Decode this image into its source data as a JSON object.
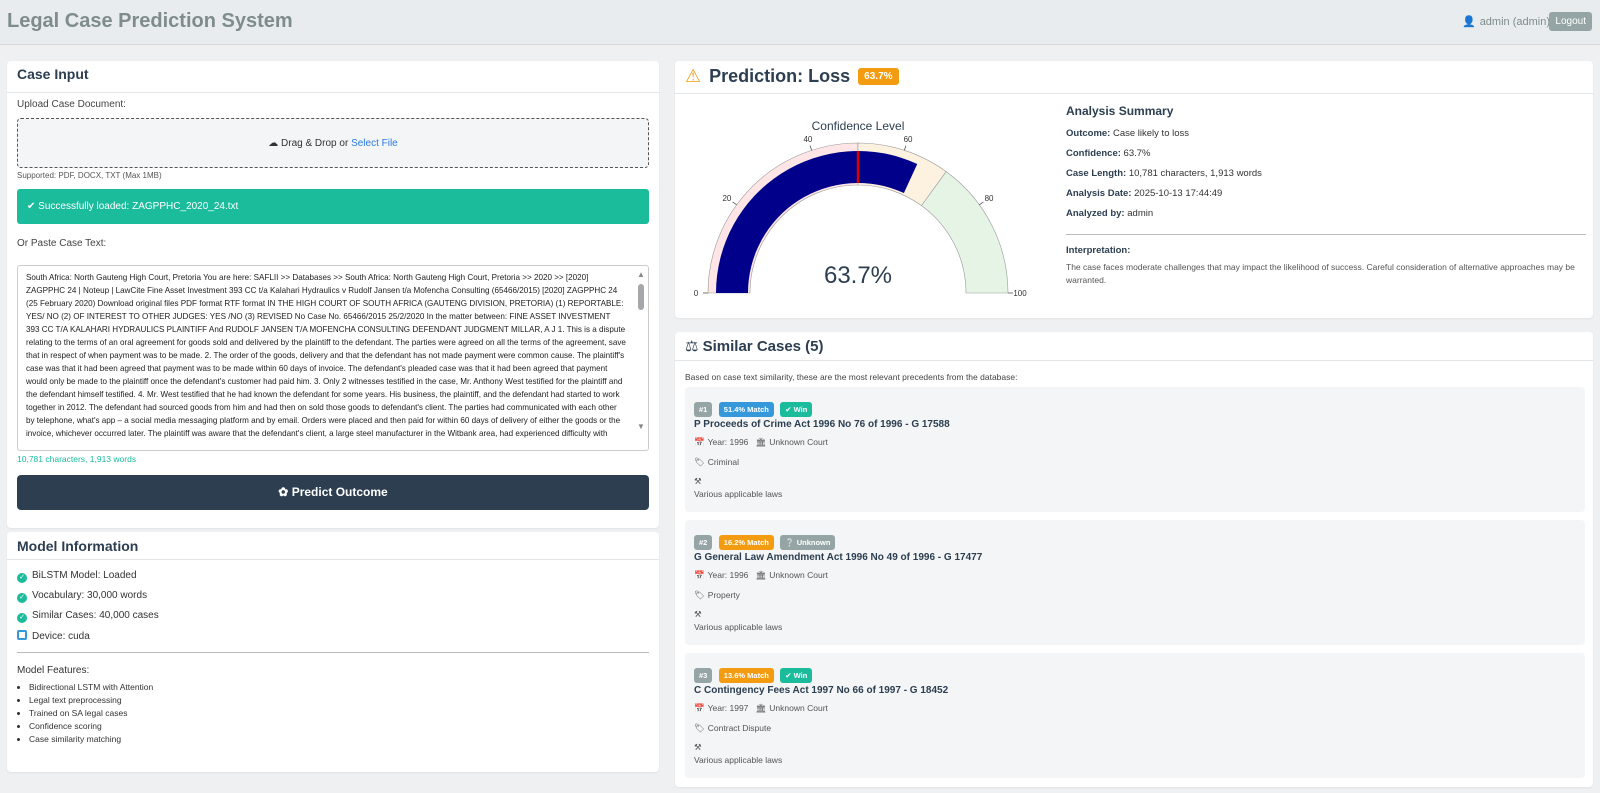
{
  "app": {
    "title": "Legal Case Prediction System"
  },
  "user": {
    "label": "admin (admin)",
    "logout": "Logout"
  },
  "case_input": {
    "title": "Case Input",
    "upload_label": "Upload Case Document:",
    "drop_text": "Drag & Drop or",
    "select_file": "Select File",
    "supported": "Supported: PDF, DOCX, TXT (Max 1MB)",
    "success": "Successfully loaded: ZAGPPHC_2020_24.txt",
    "paste_label": "Or Paste Case Text:",
    "text": "South Africa: North Gauteng High Court, Pretoria You are here: SAFLII >> Databases >> South Africa: North Gauteng High Court, Pretoria >> 2020 >> [2020] ZAGPPHC 24 | Noteup | LawCite Fine Asset Investment 393 CC t/a Kalahari Hydraulics v Rudolf Jansen t/a Mofencha Consulting (65466/2015) [2020] ZAGPPHC 24 (25 February 2020) Download original files PDF format RTF format IN THE HIGH COURT OF SOUTH AFRICA (GAUTENG DIVISION, PRETORIA) (1) REPORTABLE: YES/ NO (2) OF INTEREST TO OTHER JUDGES: YES /NO (3) REVISED No Case No. 65466/2015 25/2/2020 In the matter between: FINE ASSET INVESTMENT 393 CC T/A KALAHARI HYDRAULICS PLAINTIFF And RUDOLF JANSEN T/A MOFENCHA CONSULTING DEFENDANT JUDGMENT MILLAR, A J 1. This is a dispute relating to the terms of an oral agreement for goods sold and delivered by the plaintiff to the defendant. The parties were agreed on all the terms of the agreement, save that in respect of when payment was to be made. 2. The order of the goods, delivery and that the defendant has not made payment were common cause. The plaintiff's case was that it had been agreed that payment was to be made within 60 days of invoice. The defendant's pleaded case was that it had been agreed that payment would only be made to the plaintiff once the defendant's customer had paid him. 3. Only 2 witnesses testified in the case, Mr. Anthony West testified for the plaintiff and the defendant himself testified. 4. Mr. West testified that he had known the defendant for some years. His business, the plaintiff, and the defendant had started to work together in 2012. The defendant had sourced goods from him and had then on sold those goods to defendant's client. The parties had communicated with each other by telephone, what's app – a social media messaging platform and by email. Orders were placed and then paid for within 60 days of delivery of either the goods or the invoice, whichever occurred later. The plaintiff was aware that the defendant's client, a large steel manufacturer in the Witbank area, had experienced difficulty with",
    "counter": "10,781 characters, 1,913 words",
    "predict_button": "Predict Outcome"
  },
  "model_info": {
    "title": "Model Information",
    "items": [
      "BiLSTM Model: Loaded",
      "Vocabulary: 30,000 words",
      "Similar Cases: 40,000 cases",
      "Device: cuda"
    ],
    "features_title": "Model Features:",
    "features": [
      "Bidirectional LSTM with Attention",
      "Legal text preprocessing",
      "Trained on SA legal cases",
      "Confidence scoring",
      "Case similarity matching"
    ]
  },
  "prediction": {
    "title": "Prediction: Loss",
    "badge": "63.7%",
    "summary_title": "Analysis Summary",
    "rows": [
      {
        "k": "Outcome:",
        "v": "Case likely to loss"
      },
      {
        "k": "Confidence:",
        "v": "63.7%"
      },
      {
        "k": "Case Length:",
        "v": "10,781 characters, 1,913 words"
      },
      {
        "k": "Analysis Date:",
        "v": "2025-10-13 17:44:49"
      },
      {
        "k": "Analyzed by:",
        "v": "admin"
      }
    ],
    "interpretation_title": "Interpretation:",
    "interpretation": "The case faces moderate challenges that may impact the likelihood of success. Careful consideration of alternative approaches may be warranted."
  },
  "chart_data": {
    "type": "gauge",
    "title": "Confidence Level",
    "value": 63.7,
    "value_label": "63.7%",
    "range": [
      0,
      100
    ],
    "threshold": 50,
    "ticks": [
      0,
      20,
      40,
      60,
      80,
      100
    ],
    "bands": [
      {
        "from": 0,
        "to": 50,
        "color": "#ffe5e5"
      },
      {
        "from": 50,
        "to": 70,
        "color": "#fdf2e0"
      },
      {
        "from": 70,
        "to": 100,
        "color": "#e6f4e6"
      }
    ],
    "bar_color": "#00008b",
    "threshold_color": "#dd0000"
  },
  "similar": {
    "title": "Similar Cases (5)",
    "description": "Based on case text similarity, these are the most relevant precedents from the database:",
    "cases": [
      {
        "rank": "#1",
        "match": "51.4% Match",
        "match_color": "#3498db",
        "outcome": "Win",
        "outcome_color": "#1abc9c",
        "title": "P Proceeds of Crime Act 1996 No 76 of 1996 - G 17588",
        "year": "Year: 1996",
        "court": "Unknown Court",
        "category": "Criminal",
        "laws": "Various applicable laws"
      },
      {
        "rank": "#2",
        "match": "16.2% Match",
        "match_color": "#f39c12",
        "outcome": "Unknown",
        "outcome_color": "#95a5a6",
        "title": "G General Law Amendment Act 1996 No 49 of 1996 - G 17477",
        "year": "Year: 1996",
        "court": "Unknown Court",
        "category": "Property",
        "laws": "Various applicable laws"
      },
      {
        "rank": "#3",
        "match": "13.6% Match",
        "match_color": "#f39c12",
        "outcome": "Win",
        "outcome_color": "#1abc9c",
        "title": "C Contingency Fees Act 1997 No 66 of 1997 - G 18452",
        "year": "Year: 1997",
        "court": "Unknown Court",
        "category": "Contract Dispute",
        "laws": "Various applicable laws"
      }
    ]
  },
  "icons": {
    "user": "user-icon",
    "cloud": "cloud-upload-icon",
    "check": "check-circle-icon",
    "brain": "brain-icon",
    "warning": "warning-icon",
    "scale": "scale-icon",
    "calendar": "calendar-icon",
    "court": "court-icon",
    "tag": "tag-icon",
    "gavel": "gavel-icon"
  }
}
